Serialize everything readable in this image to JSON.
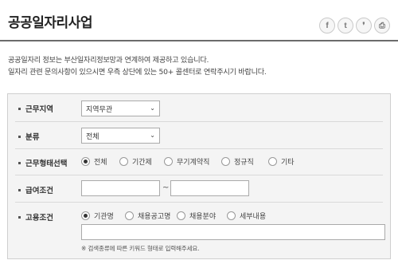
{
  "page": {
    "title": "공공일자리사업",
    "intro_line1": "공공일자리 정보는 부산일자리정보망과 연계하여 제공하고 있습니다.",
    "intro_line2": "일자리 관련 문의사항이 있으시면 우측 상단에 있는 50+ 콜센터로 연락주시기 바랍니다."
  },
  "share": {
    "facebook_glyph": "f",
    "twitter_glyph": "t",
    "kakao_glyph": "❜",
    "print_glyph": "⎙"
  },
  "form": {
    "region": {
      "label": "근무지역",
      "selected": "지역무관",
      "arrow": "⌄"
    },
    "category": {
      "label": "분류",
      "selected": "전체",
      "arrow": "⌄"
    },
    "employment_type": {
      "label": "근무형태선택",
      "options": [
        "전체",
        "기간제",
        "무기계약직",
        "정규직",
        "기타"
      ],
      "selected_index": 0
    },
    "salary": {
      "label": "급여조건",
      "separator": "~"
    },
    "employment": {
      "label": "고용조건",
      "options": [
        "기관명",
        "채용공고명",
        "채용분야",
        "세부내용"
      ],
      "selected_index": 0,
      "note": "※ 검색종류에 따른 키워드 형태로 입력해주세요."
    }
  }
}
